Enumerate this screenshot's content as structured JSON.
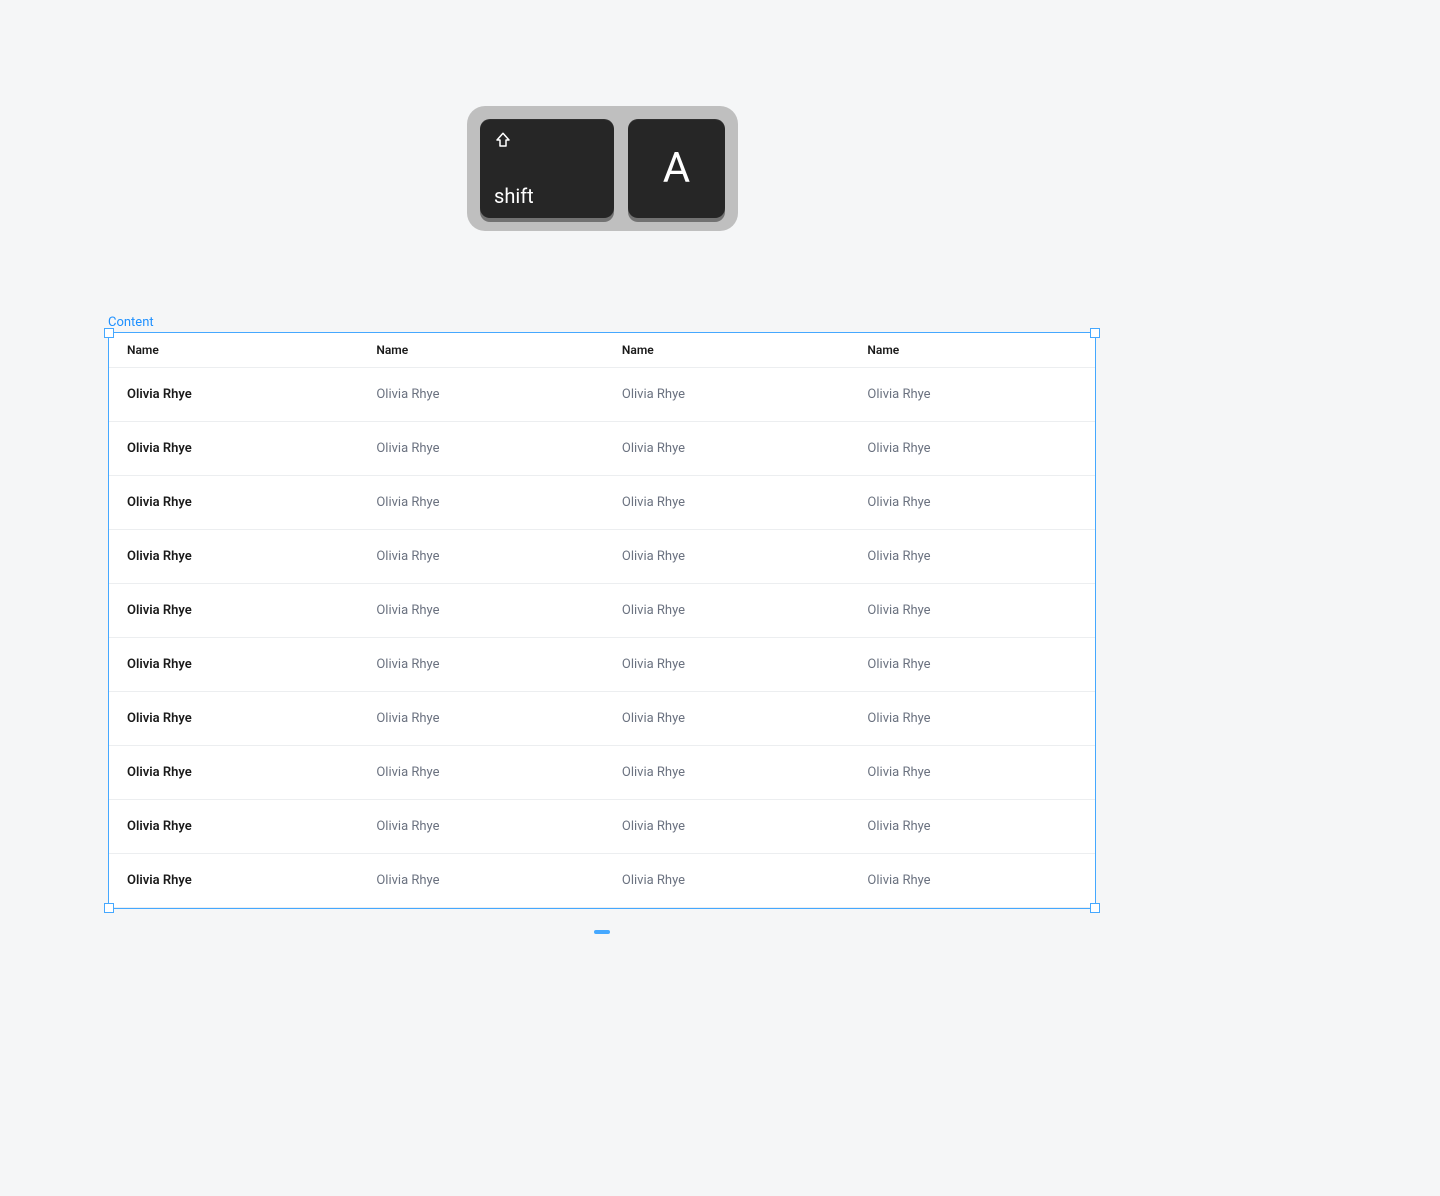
{
  "shortcut": {
    "key1_label": "shift",
    "key2_label": "A"
  },
  "frame": {
    "label": "Content"
  },
  "table": {
    "columns": [
      "Name",
      "Name",
      "Name",
      "Name"
    ],
    "rows": [
      [
        "Olivia Rhye",
        "Olivia Rhye",
        "Olivia Rhye",
        "Olivia Rhye"
      ],
      [
        "Olivia Rhye",
        "Olivia Rhye",
        "Olivia Rhye",
        "Olivia Rhye"
      ],
      [
        "Olivia Rhye",
        "Olivia Rhye",
        "Olivia Rhye",
        "Olivia Rhye"
      ],
      [
        "Olivia Rhye",
        "Olivia Rhye",
        "Olivia Rhye",
        "Olivia Rhye"
      ],
      [
        "Olivia Rhye",
        "Olivia Rhye",
        "Olivia Rhye",
        "Olivia Rhye"
      ],
      [
        "Olivia Rhye",
        "Olivia Rhye",
        "Olivia Rhye",
        "Olivia Rhye"
      ],
      [
        "Olivia Rhye",
        "Olivia Rhye",
        "Olivia Rhye",
        "Olivia Rhye"
      ],
      [
        "Olivia Rhye",
        "Olivia Rhye",
        "Olivia Rhye",
        "Olivia Rhye"
      ],
      [
        "Olivia Rhye",
        "Olivia Rhye",
        "Olivia Rhye",
        "Olivia Rhye"
      ],
      [
        "Olivia Rhye",
        "Olivia Rhye",
        "Olivia Rhye",
        "Olivia Rhye"
      ]
    ]
  }
}
